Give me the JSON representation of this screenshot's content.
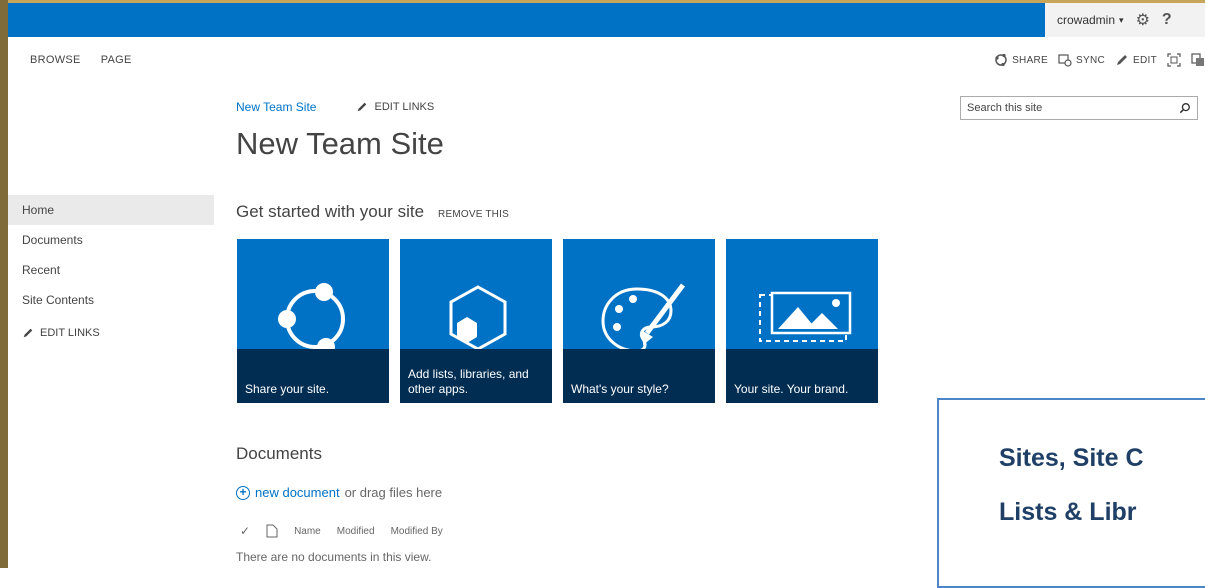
{
  "suitebar": {
    "user_name": "crowadmin",
    "user_caret": "▾",
    "settings_icon": "gear-icon",
    "help_label": "?"
  },
  "ribbon": {
    "tabs": [
      "BROWSE",
      "PAGE"
    ],
    "actions": [
      {
        "label": "SHARE",
        "icon": "share-icon"
      },
      {
        "label": "SYNC",
        "icon": "sync-icon"
      },
      {
        "label": "EDIT",
        "icon": "pencil-icon"
      }
    ]
  },
  "breadcrumb": {
    "site_link": "New Team Site",
    "edit_links": "EDIT LINKS"
  },
  "page_title": "New Team Site",
  "search": {
    "placeholder": "Search this site"
  },
  "left_nav": {
    "items": [
      "Home",
      "Documents",
      "Recent",
      "Site Contents"
    ],
    "active_index": 0,
    "edit_links": "EDIT LINKS"
  },
  "get_started": {
    "title": "Get started with your site",
    "remove_label": "REMOVE THIS",
    "tiles": [
      {
        "caption": "Share your site.",
        "icon": "share-circle-icon"
      },
      {
        "caption": "Add lists, libraries, and other apps.",
        "icon": "hexagon-apps-icon"
      },
      {
        "caption": "What's your style?",
        "icon": "palette-icon"
      },
      {
        "caption": "Your site. Your brand.",
        "icon": "brand-image-icon"
      }
    ]
  },
  "documents": {
    "title": "Documents",
    "new_link": "new document",
    "new_suffix": "or drag files here",
    "columns": [
      "Name",
      "Modified",
      "Modified By"
    ],
    "empty_message": "There are no documents in this view."
  },
  "callout": {
    "line1": "Sites, Site C",
    "line2": "Lists & Libr"
  },
  "colors": {
    "suite_blue": "#0072c6",
    "tile_caption": "#022d52",
    "callout_text": "#1f3f66",
    "callout_border": "#4c86c6"
  }
}
